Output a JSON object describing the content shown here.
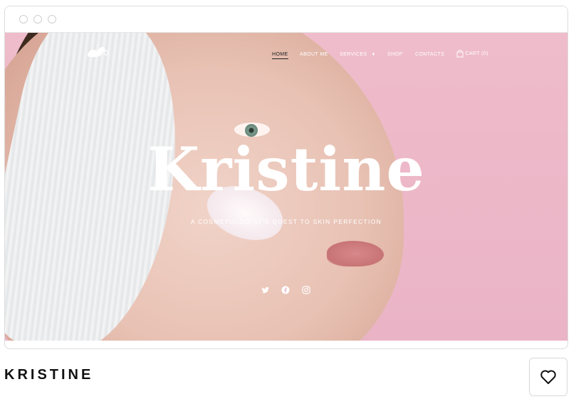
{
  "browser": {
    "dots": [
      "close",
      "minimize",
      "maximize"
    ]
  },
  "nav": {
    "logo_icon": "swan-logo-icon",
    "items": [
      {
        "label": "HOME",
        "active": true
      },
      {
        "label": "ABOUT ME"
      },
      {
        "label": "SERVICES"
      },
      {
        "label": "SHOP"
      },
      {
        "label": "CONTACTS"
      }
    ],
    "cart_label": "CART (0)",
    "cart_icon": "shopping-bag-icon"
  },
  "hero": {
    "title": "Kristine",
    "tagline": "A COSMETOLOGIST'S QUEST TO SKIN PERFECTION",
    "social": [
      "twitter-icon",
      "facebook-icon",
      "instagram-icon"
    ]
  },
  "product": {
    "name": "KRISTINE",
    "favorite_icon": "heart-icon"
  },
  "colors": {
    "hero_pink": "#eab4c6",
    "text_dark": "#111111"
  }
}
